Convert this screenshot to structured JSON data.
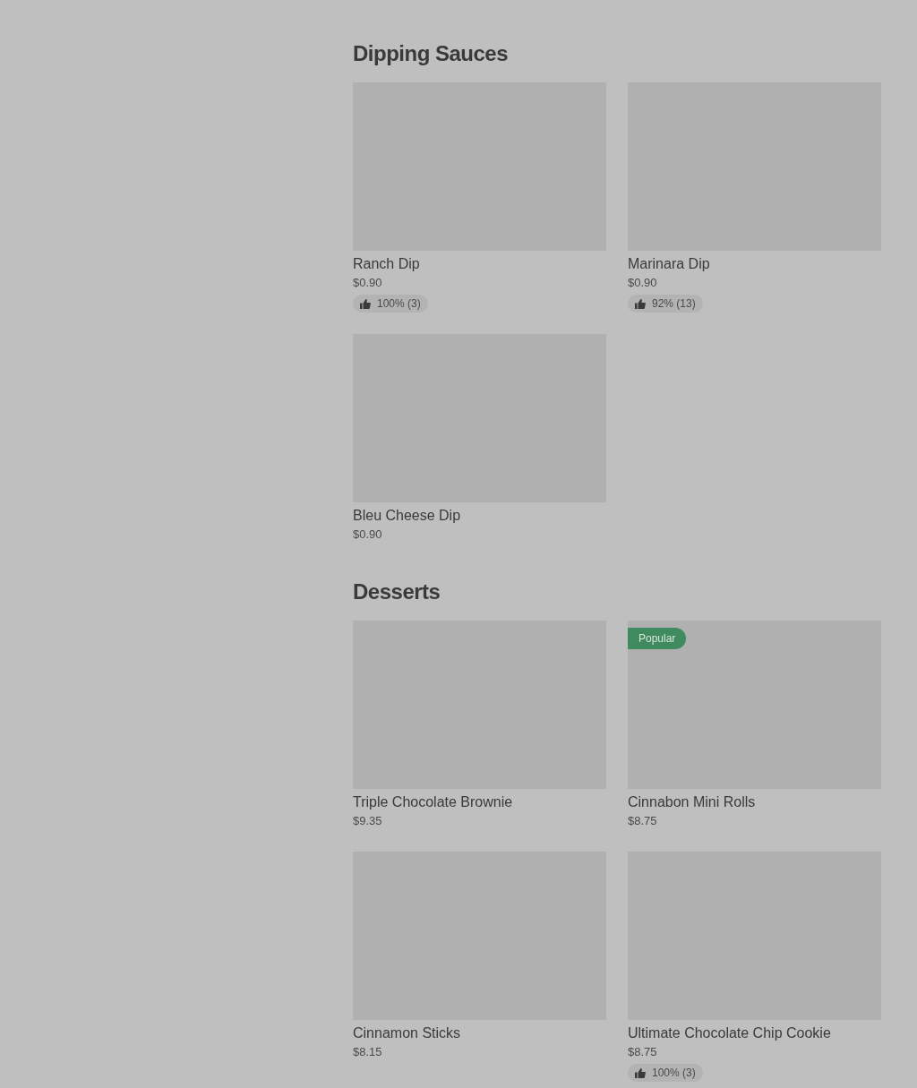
{
  "sections": [
    {
      "title": "Dipping Sauces",
      "rows": [
        [
          {
            "name": "Ranch Dip",
            "price": "$0.90",
            "rating": "100% (3)"
          },
          {
            "name": "Marinara Dip",
            "price": "$0.90",
            "rating": "92% (13)"
          }
        ],
        [
          {
            "name": "Bleu Cheese Dip",
            "price": "$0.90"
          }
        ]
      ]
    },
    {
      "title": "Desserts",
      "rows": [
        [
          {
            "name": "Triple Chocolate Brownie",
            "price": "$9.35"
          },
          {
            "badge": "Popular",
            "name": "Cinnabon Mini Rolls",
            "price": "$8.75"
          }
        ],
        [
          {
            "name": "Cinnamon Sticks",
            "price": "$8.15"
          },
          {
            "name": "Ultimate Chocolate Chip Cookie",
            "price": "$8.75",
            "rating": "100% (3)"
          }
        ]
      ]
    }
  ]
}
